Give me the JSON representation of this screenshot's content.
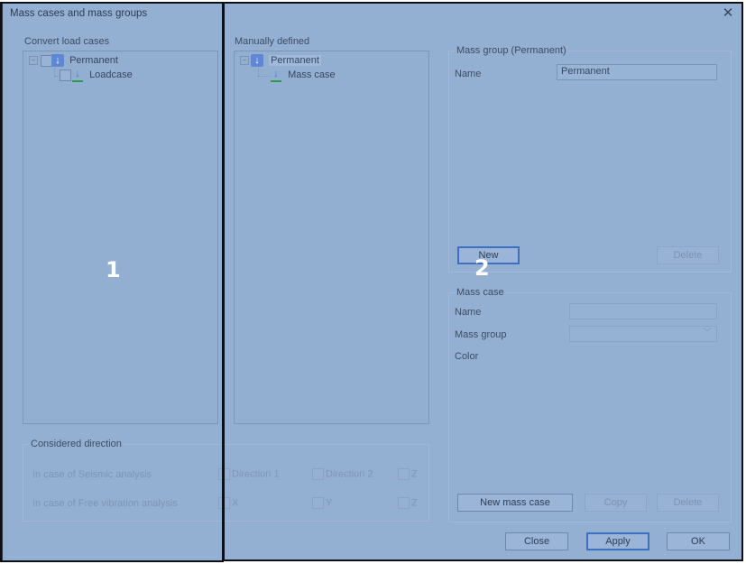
{
  "dialog": {
    "title": "Mass cases and mass groups"
  },
  "left": {
    "label": "Convert load cases",
    "tree": [
      {
        "label": "Permanent",
        "icon": "load-group-icon"
      },
      {
        "label": "Loadcase",
        "icon": "load-case-icon"
      }
    ]
  },
  "middle": {
    "label": "Manually defined",
    "tree": [
      {
        "label": "Permanent",
        "icon": "mass-group-icon"
      },
      {
        "label": "Mass case",
        "icon": "mass-case-icon"
      }
    ]
  },
  "mass_group": {
    "legend": "Mass group (Permanent)",
    "name_label": "Name",
    "name_value": "Permanent",
    "new_button": "New",
    "delete_button": "Delete"
  },
  "mass_case": {
    "legend": "Mass case",
    "name_label": "Name",
    "name_value": "",
    "group_label": "Mass group",
    "group_value": "",
    "color_label": "Color",
    "new_button": "New mass case",
    "copy_button": "Copy",
    "delete_button": "Delete"
  },
  "considered": {
    "legend": "Considered direction",
    "seismic_label": "In case of Seismic analysis",
    "seismic_options": [
      "Direction 1",
      "Direction 2",
      "Z"
    ],
    "free_label": "In case of Free vibration analysis",
    "free_options": [
      "X",
      "Y",
      "Z"
    ]
  },
  "footer": {
    "close_button": "Close",
    "apply_button": "Apply",
    "ok_button": "OK"
  },
  "annotations": {
    "region1": "1",
    "region2": "2"
  },
  "colors": {
    "dialog_bg": "#93b0d3",
    "accent": "#3d6fc4",
    "annotation_border": "#0d0f14"
  }
}
